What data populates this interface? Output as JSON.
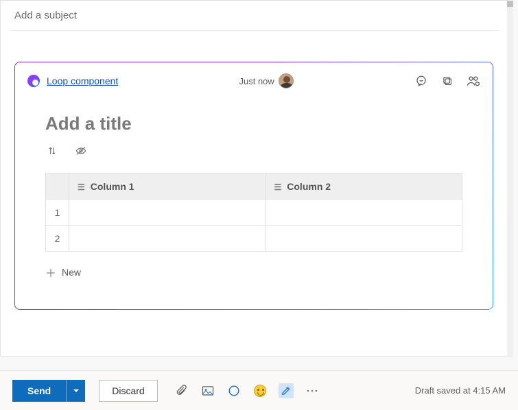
{
  "subject_placeholder": "Add a subject",
  "loop": {
    "link_label": "Loop component",
    "timestamp": "Just now",
    "title_placeholder": "Add a title",
    "columns": [
      "Column 1",
      "Column 2"
    ],
    "rows": [
      "1",
      "2"
    ],
    "new_row_label": "New"
  },
  "bottom": {
    "send": "Send",
    "discard": "Discard",
    "status": "Draft saved at 4:15 AM"
  }
}
